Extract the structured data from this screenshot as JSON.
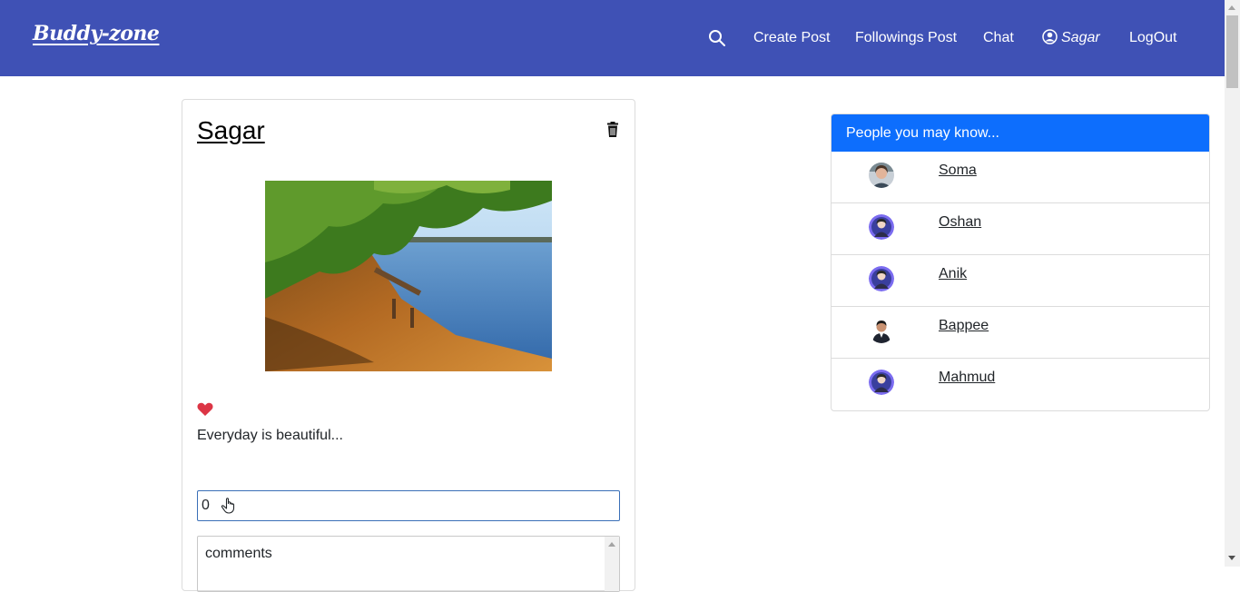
{
  "navbar": {
    "brand": "Buddy-zone",
    "links": {
      "create_post": "Create Post",
      "followings_post": "Followings Post",
      "chat": "Chat",
      "user": "Sagar",
      "logout": "LogOut"
    },
    "icons": {
      "search": "search-icon",
      "user": "user-circle-icon"
    }
  },
  "post": {
    "author": "Sagar",
    "text": "Everyday is beautiful...",
    "likes": "0",
    "comments_label": "comments",
    "icons": {
      "delete": "trash-icon",
      "favorite": "heart-icon",
      "like": "thumbs-up-icon"
    }
  },
  "suggestions": {
    "header": "People you may know...",
    "people": [
      {
        "name": "Soma",
        "avatar": "photo"
      },
      {
        "name": "Oshan",
        "avatar": "default"
      },
      {
        "name": "Anik",
        "avatar": "default"
      },
      {
        "name": "Bappee",
        "avatar": "photo"
      },
      {
        "name": "Mahmud",
        "avatar": "default"
      }
    ]
  },
  "colors": {
    "navbar_bg": "#3f51b5",
    "suggest_header_bg": "#0d6efd",
    "heart": "#dc3545",
    "like_border": "#3a6fb7"
  }
}
